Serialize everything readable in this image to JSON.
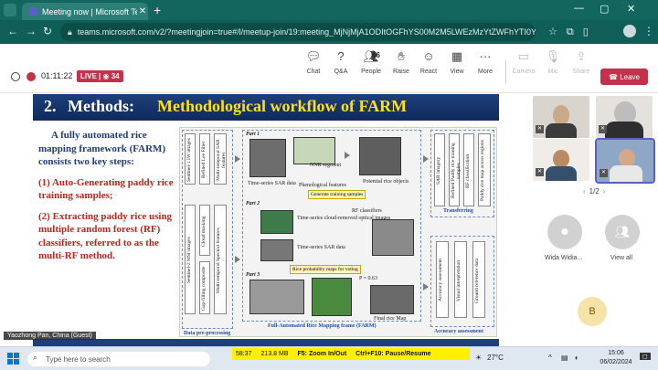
{
  "browser": {
    "tab_title": "Meeting now | Microsoft Te",
    "tab_close": "✕",
    "new_tab": "+",
    "url": "teams.microsoft.com/v2/?meetingjoin=true#/l/meetup-join/19:meeting_MjNjMjA1ODItOGFhYS00M2M5LWEzMzYtZWFhYTI0YzliMGNi@thre...",
    "win_min": "—",
    "win_max": "▢",
    "win_close": "✕"
  },
  "meeting": {
    "timer": "01:11:22",
    "live_label": "LIVE",
    "live_count": "34",
    "participants_count": "46",
    "leave_label": "Leave",
    "toolbar": [
      {
        "label": "Chat",
        "icon": "chat-icon"
      },
      {
        "label": "Q&A",
        "icon": "qa-icon"
      },
      {
        "label": "People",
        "icon": "people-icon"
      },
      {
        "label": "Raise",
        "icon": "raise-hand-icon"
      },
      {
        "label": "React",
        "icon": "react-icon"
      },
      {
        "label": "View",
        "icon": "view-icon"
      },
      {
        "label": "More",
        "icon": "more-icon"
      },
      {
        "label": "Camera",
        "icon": "camera-icon"
      },
      {
        "label": "Mic",
        "icon": "mic-icon"
      },
      {
        "label": "Share",
        "icon": "share-icon"
      }
    ]
  },
  "slide": {
    "number": "2.",
    "title_prefix": "Methods:",
    "title": "Methodological workflow of FARM",
    "intro": "A fully automated rice mapping framework (FARM) consists two key steps:",
    "step1": "(1) Auto-Generating paddy rice training samples;",
    "step2_prefix": "(2) Extracting paddy rice using multiple random forest (RF) classifiers, referred to as the",
    "step2_highlight": "multi-RF",
    "step2_suffix": "method.",
    "diagram": {
      "part1": "Part 1",
      "part2": "Part 2",
      "part3": "Part 3",
      "s1_images": "Sentinel-1 IW images",
      "refined_lee": "Refined Lee Filter",
      "multi_sar": "Multi-temporal SAR features",
      "s2_images": "Sentinel-2 MSI images",
      "cloud_masking": "Cloud masking",
      "gapfill": "Gap-filling composite",
      "multi_spectral": "Multi-temporal Spectral features",
      "preprocessing": "Data pre-processing",
      "ts_sar": "Time-series SAR data",
      "phen": "Phenological features",
      "nnr": "NNR segment",
      "potential": "Potential rice objects",
      "gen_samples": "Generate training samples",
      "rf_classifiers": "RF classifiers",
      "ts_optical": "Time-series cloud-removed optical images",
      "ts_sar2": "Time-series SAR data",
      "prob_maps": "Rice probability maps for voting",
      "p_value": "P = 0.63",
      "final_map": "Final rice Map",
      "farm_caption": "Full-Automated Rice Mapping frame (FARM)",
      "sar_imagery": "SAR imagery",
      "refined_samples": "Refined Paddy rice training samples",
      "rf_class": "RF classification",
      "paddy_map": "Paddy rice map across regions",
      "transferring": "Transferring",
      "accuracy": "Accuracy assessment",
      "visual": "Visual interpretation",
      "ground": "Ground reference data",
      "acc_eval": "Accuracy assessment"
    }
  },
  "speaker_label": "Yaozhong Pan, China (Guest)",
  "roster": {
    "page": "1/2",
    "attendee_name": "Wida Widia...",
    "view_all": "View all",
    "self_initial": "B"
  },
  "taskbar": {
    "search_placeholder": "Type here to search",
    "overlay_time": "58:37",
    "overlay_size": "213.8 MB",
    "overlay_zoom": "F5: Zoom In/Out",
    "overlay_pause": "Ctrl+F10: Pause/Resume",
    "temperature": "27°C",
    "time": "15:06",
    "date": "06/02/2024"
  }
}
